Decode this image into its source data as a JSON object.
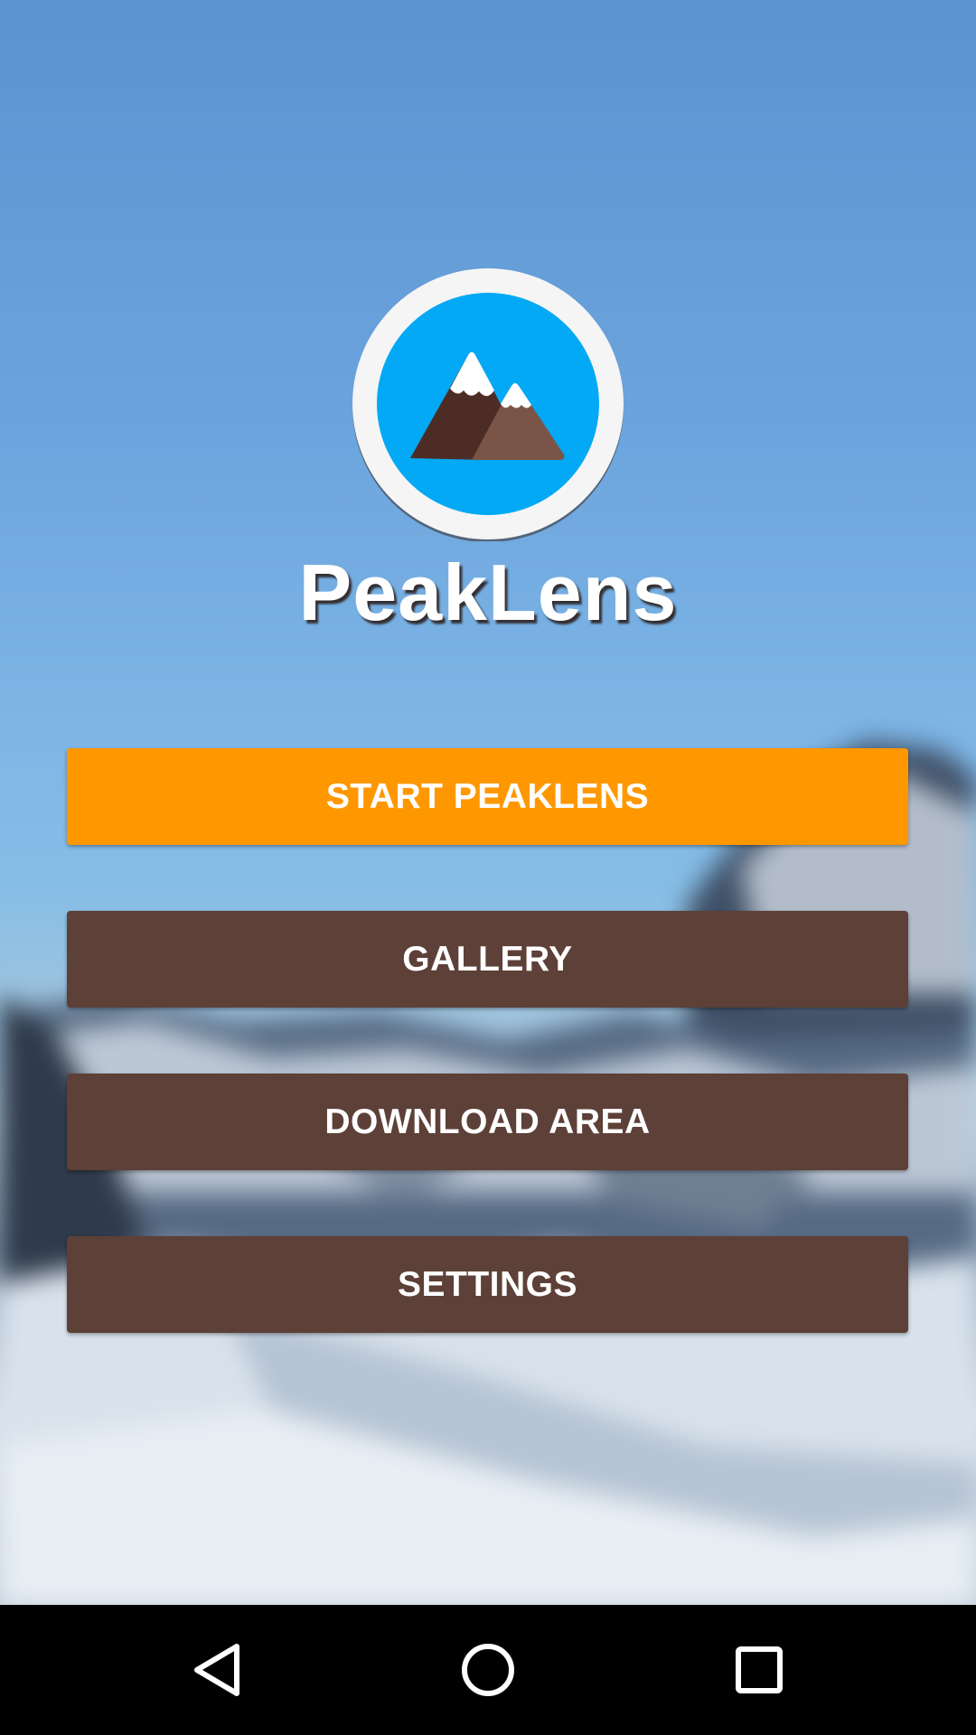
{
  "app": {
    "title": "PeakLens",
    "logo_icon": "mountain-logo-icon"
  },
  "menu": {
    "start_label": "START PEAKLENS",
    "gallery_label": "GALLERY",
    "download_label": "DOWNLOAD AREA",
    "settings_label": "SETTINGS"
  },
  "colors": {
    "primary_button": "#ff9800",
    "secondary_button": "#5d4037",
    "logo_circle": "#03a9f4",
    "logo_ring": "#f5f5f5",
    "mountain_dark": "#4e2c26",
    "mountain_light": "#7b5448",
    "navbar": "#000000"
  },
  "navbar": {
    "back_icon": "back-triangle-icon",
    "home_icon": "home-circle-icon",
    "recents_icon": "recents-square-icon"
  }
}
